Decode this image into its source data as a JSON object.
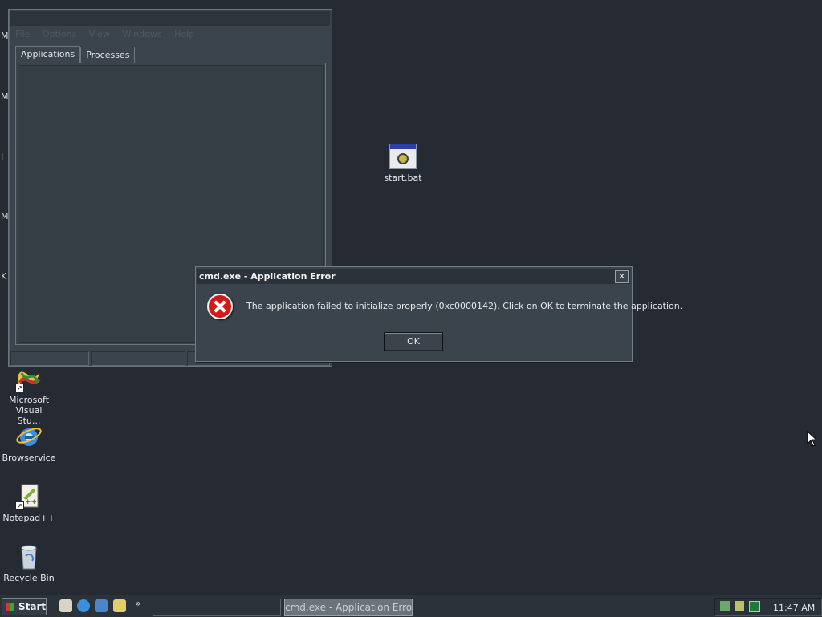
{
  "desktop": {
    "icons": [
      {
        "label": "start.bat"
      },
      {
        "label": "Microsoft Visual Stu..."
      },
      {
        "label": "Browservice"
      },
      {
        "label": "Notepad++"
      },
      {
        "label": "Recycle Bin"
      }
    ],
    "clipped_letters": [
      "M",
      "M",
      "I",
      "M",
      "K"
    ]
  },
  "task_manager": {
    "menu": [
      "File",
      "Options",
      "View",
      "Windows",
      "Help"
    ],
    "tabs": [
      "Applications",
      "Processes"
    ]
  },
  "dialog": {
    "title": "cmd.exe - Application Error",
    "message": "The application failed to initialize properly (0xc0000142). Click on OK to terminate the application.",
    "ok_label": "OK",
    "close_label": "✕"
  },
  "taskbar": {
    "start_label": "Start",
    "quicklaunch_more": "»",
    "active_task": "cmd.exe - Application Error",
    "clock": "11:47 AM"
  },
  "colors": {
    "desktop": "#262b33",
    "window": "#3b434c",
    "error_red": "#d31a1a"
  }
}
